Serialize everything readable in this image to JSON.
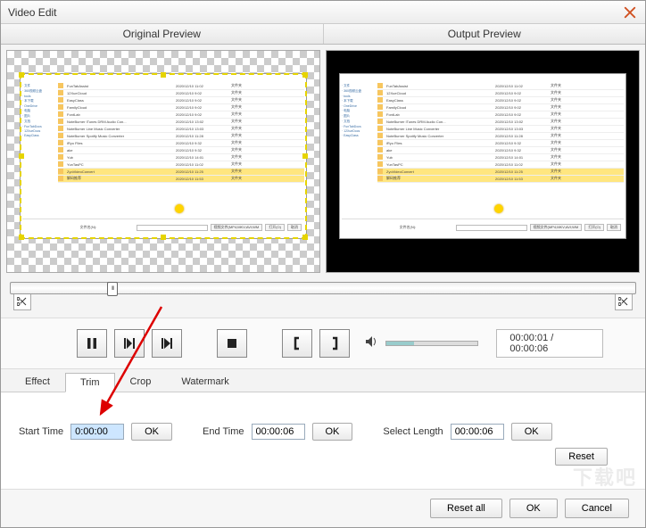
{
  "dialog": {
    "title": "Video Edit"
  },
  "preview": {
    "original_label": "Original Preview",
    "output_label": "Output Preview"
  },
  "thumb_sidebar": [
    "文件",
    "360视频云盘",
    "tools",
    "本下载",
    "OneDrive",
    "电脑",
    "图片",
    "文档",
    "FunTabDocs",
    "12XueDocs",
    "EasyClass"
  ],
  "thumb_rows": [
    {
      "name": "FunTabAssist",
      "date": "2020/12/10 11:02",
      "type": "文件夹"
    },
    {
      "name": "12XueCloud",
      "date": "2020/12/10 9:02",
      "type": "文件夹"
    },
    {
      "name": "EasyClass",
      "date": "2020/12/10 9:02",
      "type": "文件夹"
    },
    {
      "name": "FamilyCloud",
      "date": "2020/12/10 9:02",
      "type": "文件夹"
    },
    {
      "name": "FontLab",
      "date": "2020/12/10 9:02",
      "type": "文件夹"
    },
    {
      "name": "NoteBurner iTunes DRM Audio Con...",
      "date": "2020/12/10 13:02",
      "type": "文件夹"
    },
    {
      "name": "NoteBurner Line Music Converter",
      "date": "2020/12/10 13:03",
      "type": "文件夹"
    },
    {
      "name": "NoteBurner Spotify Music Converter",
      "date": "2020/12/10 11:28",
      "type": "文件夹"
    },
    {
      "name": "iRyo Files",
      "date": "2020/12/10 9:32",
      "type": "文件夹"
    },
    {
      "name": "ake",
      "date": "2020/12/10 9:32",
      "type": "文件夹"
    },
    {
      "name": "Yub",
      "date": "2020/12/10 14:01",
      "type": "文件夹"
    },
    {
      "name": "YunTasPC",
      "date": "2020/12/10 11:02",
      "type": "文件夹"
    },
    {
      "name": "ZyoVideoConvert",
      "date": "2020/12/10 11:25",
      "type": "文件夹"
    },
    {
      "name": "解码推荐",
      "date": "2020/12/10 11:53",
      "type": "文件夹"
    }
  ],
  "thumb_footer": {
    "label": "文件名(N):",
    "filter": "视频文件(MP4;MKV;AVI;WM",
    "open": "打开(O)",
    "cancel": "取消"
  },
  "playback": {
    "time_display": "00:00:01 / 00:00:06"
  },
  "tabs": {
    "effect": "Effect",
    "trim": "Trim",
    "crop": "Crop",
    "watermark": "Watermark"
  },
  "trim": {
    "start_label": "Start Time",
    "start_value": "0:00:00",
    "start_ok": "OK",
    "end_label": "End Time",
    "end_value": "00:00:06",
    "end_ok": "OK",
    "length_label": "Select Length",
    "length_value": "00:00:06",
    "length_ok": "OK",
    "reset": "Reset"
  },
  "footer": {
    "reset_all": "Reset all",
    "ok": "OK",
    "cancel": "Cancel"
  },
  "watermark_brand": "下载吧"
}
